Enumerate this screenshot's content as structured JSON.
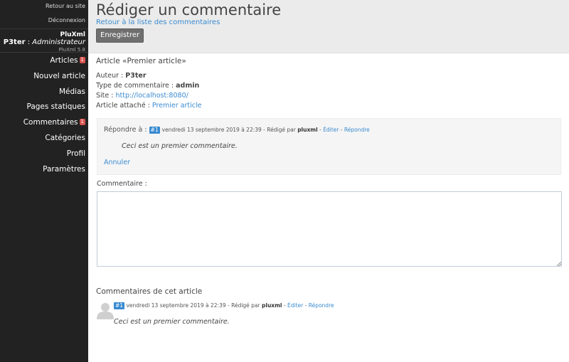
{
  "sidebar": {
    "top_links": [
      "Retour au site",
      "Déconnexion"
    ],
    "profile": {
      "app": "PluXml",
      "user_name": "P3ter",
      "separator": " : ",
      "role": "Administrateur",
      "version": "PluXml 5.8"
    },
    "nav": [
      {
        "label": "Articles",
        "badge": "1"
      },
      {
        "label": "Nouvel article"
      },
      {
        "label": "Médias"
      },
      {
        "label": "Pages statiques"
      },
      {
        "label": "Commentaires",
        "badge": "1"
      },
      {
        "label": "Catégories"
      },
      {
        "label": "Profil"
      },
      {
        "label": "Paramètres"
      }
    ]
  },
  "header": {
    "title": "Rédiger un commentaire",
    "back_link": "Retour à la liste des commentaires",
    "save_button": "Enregistrer"
  },
  "article": {
    "title": "Article «Premier article»",
    "author_label": "Auteur : ",
    "author": "P3ter",
    "type_label": "Type de commentaire : ",
    "type": "admin",
    "site_label": "Site : ",
    "site": "http://localhost:8080/",
    "attached_label": "Article attaché : ",
    "attached": "Premier article"
  },
  "reply": {
    "label": "Répondre à : ",
    "badge": "#1",
    "date": "vendredi 13 septembre 2019 à 22:39",
    "written_by": " - Rédigé par ",
    "author": "pluxml",
    "sep1": " - ",
    "edit": "Éditer",
    "sep2": " - ",
    "reply": "Répondre",
    "text": "Ceci est un premier commentaire.",
    "cancel": "Annuler"
  },
  "comment_form": {
    "label": "Commentaire :",
    "value": ""
  },
  "comments": {
    "title": "Commentaires de cet article",
    "items": [
      {
        "badge": "#1",
        "date": "vendredi 13 septembre 2019 à 22:39",
        "written_by": " - Rédigé par ",
        "author": "pluxml",
        "sep1": " - ",
        "edit": "Éditer",
        "sep2": " - ",
        "reply": "Répondre",
        "text": "Ceci est un premier commentaire."
      }
    ]
  },
  "colors": {
    "sidebar_bg": "#222222",
    "header_bg": "#ebebeb",
    "link": "#3a8bd0",
    "badge_red": "#d9534f",
    "badge_blue": "#3a8bd0"
  }
}
